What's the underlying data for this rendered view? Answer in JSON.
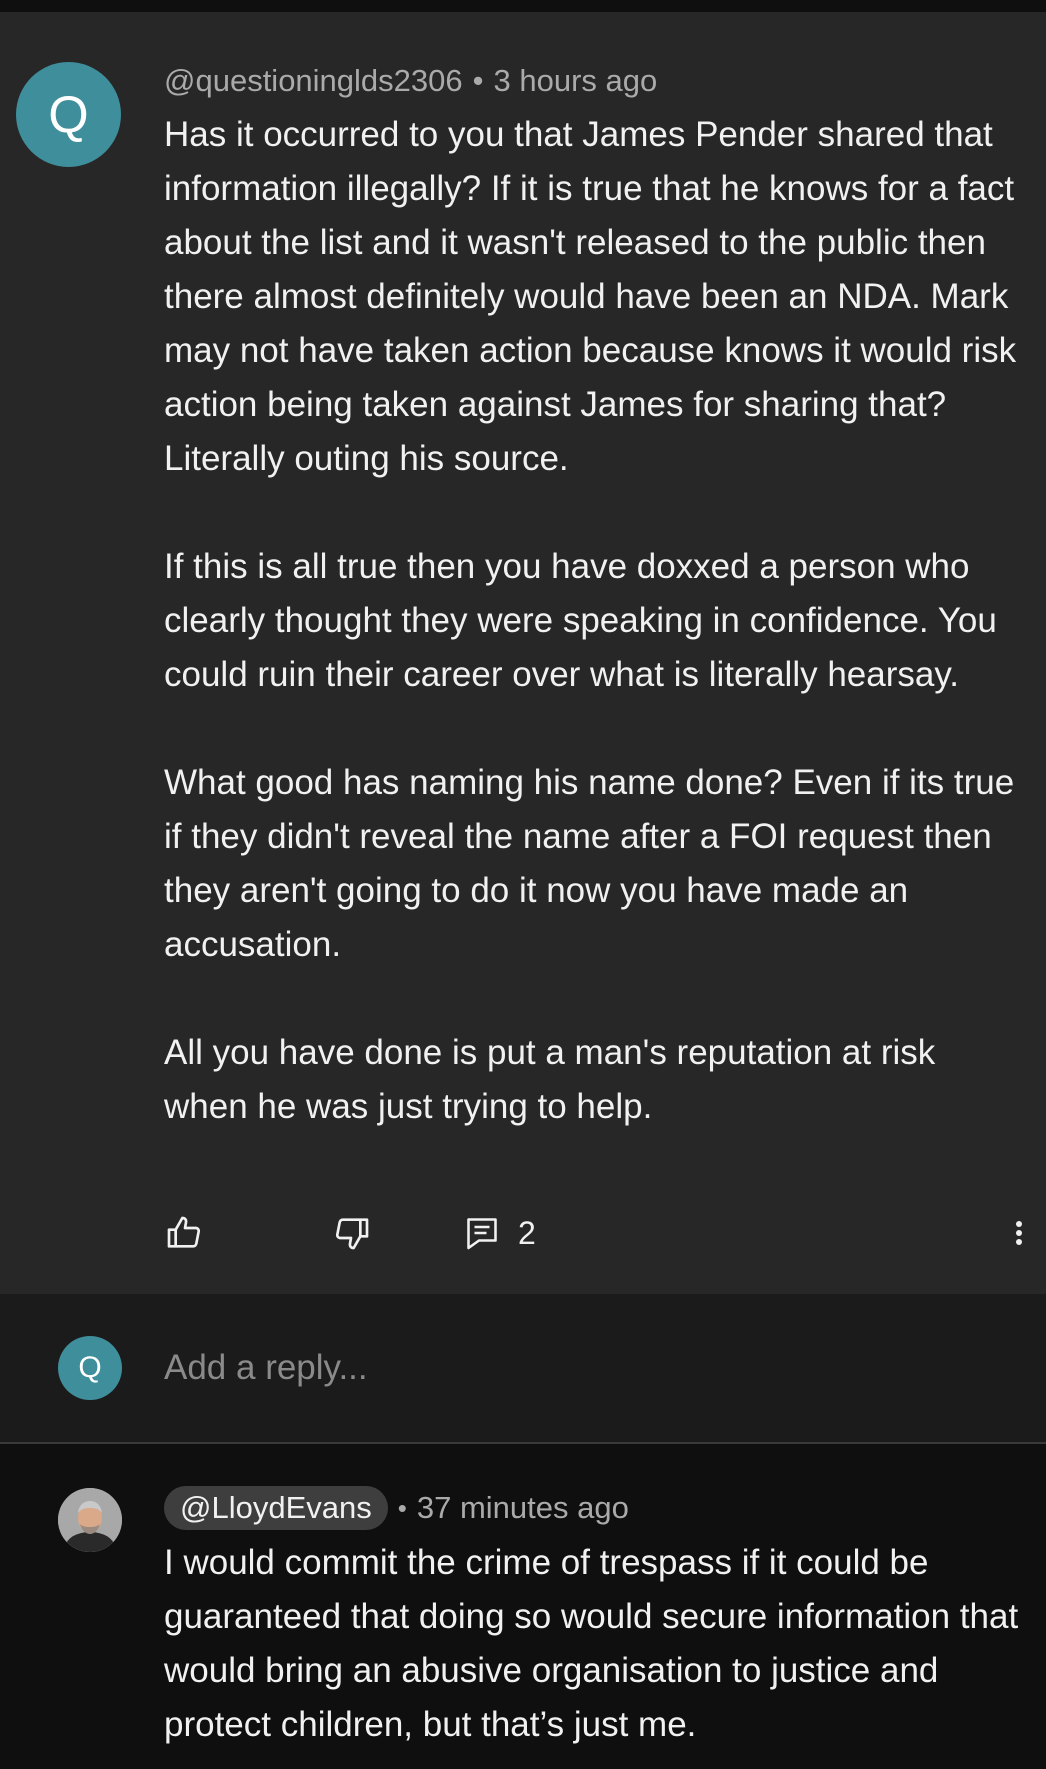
{
  "comment": {
    "avatar_letter": "Q",
    "author": "@questioninglds2306",
    "separator": "•",
    "timestamp": "3 hours ago",
    "paragraphs": [
      "Has it occurred to you that James Pender shared that information illegally? If it is true that he knows for a fact about the list and it wasn't released to the public then there almost definitely would have been an NDA. Mark may not have taken action because knows it would risk action being taken against James for sharing that? Literally outing his source.",
      "If this is all true then you have doxxed a person who clearly thought they were speaking in confidence. You could ruin their career over what is literally hearsay.",
      "What good has naming his name done? Even if its true if they didn't reveal the name after a FOI request then they aren't going to do it now you have made an accusation.",
      "All you have done is put a man's reputation at risk when he was just trying to help."
    ],
    "reply_count": "2",
    "icons": {
      "like": "thumbs-up-icon",
      "dislike": "thumbs-down-icon",
      "reply": "comment-icon",
      "more": "more-vertical-icon"
    }
  },
  "reply_box": {
    "avatar_letter": "Q",
    "placeholder": "Add a reply..."
  },
  "reply": {
    "author": "@LloydEvans",
    "separator": "•",
    "timestamp": "37 minutes ago",
    "text": "I would commit the crime of trespass if it could be guaranteed that doing so would secure information that would bring an abusive organisation to justice and protect children, but that’s just me."
  },
  "colors": {
    "avatar_teal": "#3f8e9b",
    "comment_background": "#272727",
    "page_background": "#0f0f0f",
    "text_primary": "#f1f1f1",
    "text_secondary": "#aaaaaa"
  }
}
